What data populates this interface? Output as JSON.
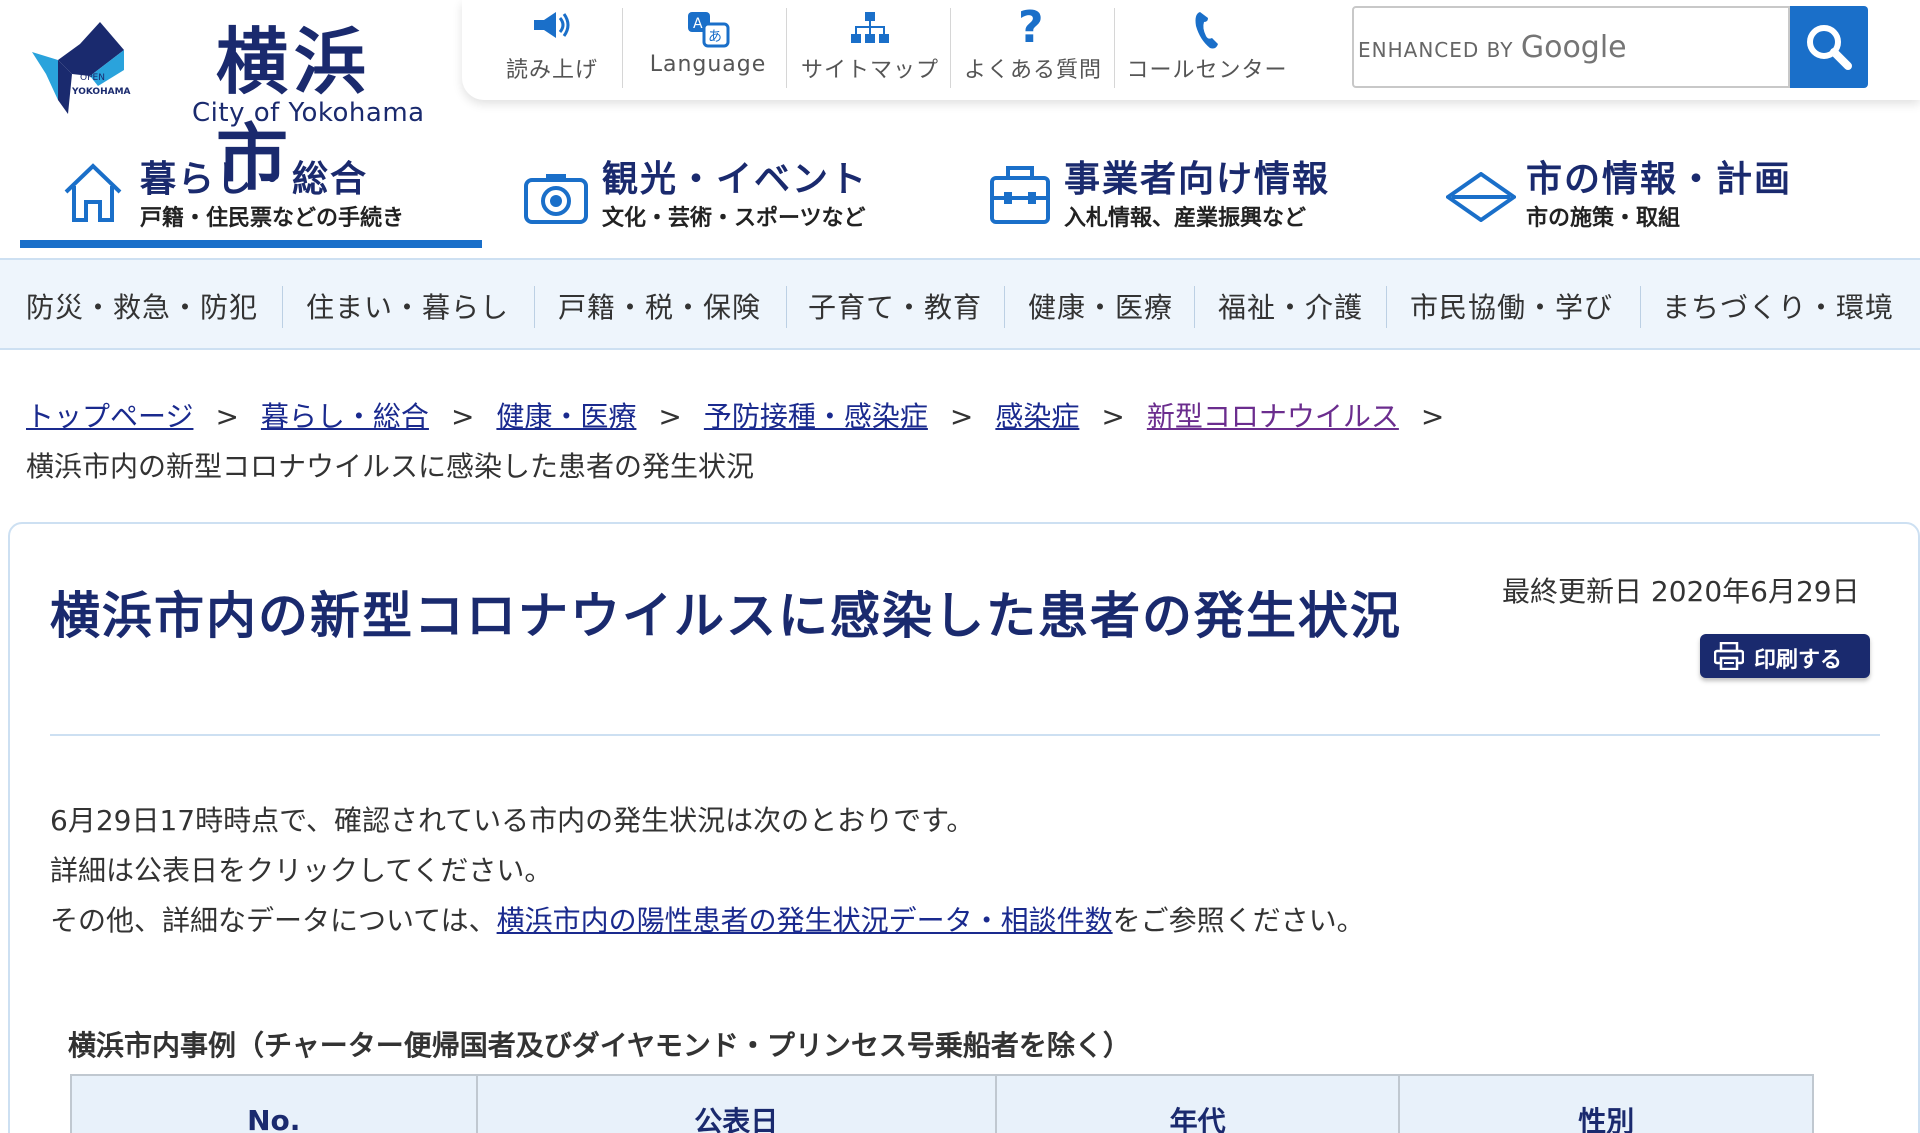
{
  "header": {
    "logo_jp": "横浜市",
    "logo_en": "City of Yokohama",
    "logo_mark_top": "OPEN",
    "logo_mark_bottom": "YOKOHAMA",
    "utility": [
      {
        "label": "読み上げ",
        "icon": "speaker-icon"
      },
      {
        "label": "Language",
        "icon": "language-icon"
      },
      {
        "label": "サイトマップ",
        "icon": "sitemap-icon"
      },
      {
        "label": "よくある質問",
        "icon": "question-icon"
      },
      {
        "label": "コールセンター",
        "icon": "phone-icon"
      }
    ],
    "search": {
      "brand_prefix": "ENHANCED BY",
      "brand_name": "Google",
      "button_icon": "search-icon"
    }
  },
  "main_nav": [
    {
      "title": "暮らし・総合",
      "sub": "戸籍・住民票などの手続き",
      "icon": "house-icon",
      "active": true
    },
    {
      "title": "観光・イベント",
      "sub": "文化・芸術・スポーツなど",
      "icon": "camera-icon",
      "active": false
    },
    {
      "title": "事業者向け情報",
      "sub": "入札情報、産業振興など",
      "icon": "toolbox-icon",
      "active": false
    },
    {
      "title": "市の情報・計画",
      "sub": "市の施策・取組",
      "icon": "diamond-icon",
      "active": false
    }
  ],
  "category_nav": [
    "防災・救急・防犯",
    "住まい・暮らし",
    "戸籍・税・保険",
    "子育て・教育",
    "健康・医療",
    "福祉・介護",
    "市民協働・学び",
    "まちづくり・環境"
  ],
  "breadcrumb": {
    "links": [
      "トップページ",
      "暮らし・総合",
      "健康・医療",
      "予防接種・感染症",
      "感染症",
      "新型コロナウイルス"
    ],
    "separator": ">",
    "current": "横浜市内の新型コロナウイルスに感染した患者の発生状況"
  },
  "content": {
    "title": "横浜市内の新型コロナウイルスに感染した患者の発生状況",
    "updated": "最終更新日 2020年6月29日",
    "print_label": "印刷する",
    "intro_line1": "6月29日17時時点で、確認されている市内の発生状況は次のとおりです。",
    "intro_line2": "詳細は公表日をクリックしてください。",
    "intro_line3_before": "その他、詳細なデータについては、",
    "intro_line3_link": "横浜市内の陽性患者の発生状況データ・相談件数",
    "intro_line3_after": "をご参照ください。",
    "table_caption": "横浜市内事例（チャーター便帰国者及びダイヤモンド・プリンセス号乗船者を除く）",
    "table_headers": [
      "No.",
      "公表日",
      "年代",
      "性別"
    ]
  },
  "colors": {
    "brand_navy": "#1a2a6e",
    "accent_blue": "#1a6fc9",
    "nav_bg": "#eef5fc",
    "visited_link": "#6b2d8e"
  }
}
